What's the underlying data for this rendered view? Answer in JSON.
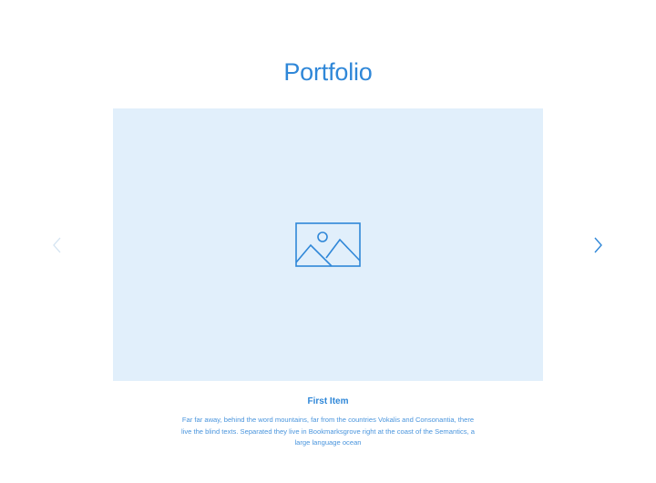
{
  "section": {
    "title": "Portfolio"
  },
  "carousel": {
    "prev_icon": "chevron-left-icon",
    "next_icon": "chevron-right-icon",
    "image_icon": "image-placeholder-icon",
    "current_item": {
      "title": "First Item",
      "description": "Far far away, behind the word mountains, far from the countries Vokalis and Consonantia, there live the blind texts. Separated they live in Bookmarksgrove right at the coast of the Semantics, a large language ocean"
    }
  },
  "colors": {
    "accent": "#2f87d8",
    "image_background": "#e1effb",
    "arrow_disabled": "#d3e3f1"
  }
}
